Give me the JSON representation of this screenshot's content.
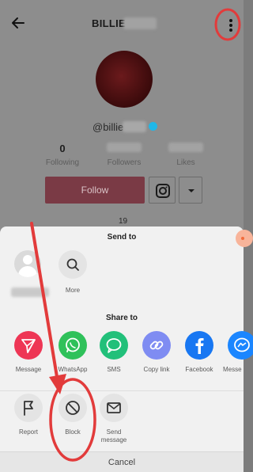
{
  "profile": {
    "username": "BILLIE",
    "handle": "@billie",
    "stats": [
      {
        "value": "0",
        "label": "Following"
      },
      {
        "value": "",
        "label": "Followers"
      },
      {
        "value": "",
        "label": "Likes"
      }
    ],
    "follow_label": "Follow",
    "video_count": "19"
  },
  "sheet": {
    "send_to_title": "Send to",
    "more_label": "More",
    "share_to_title": "Share to",
    "share_targets": [
      {
        "label": "Message",
        "icon": "send-icon",
        "color": "#ee3655"
      },
      {
        "label": "WhatsApp",
        "icon": "whatsapp-icon",
        "color": "#2fc15a"
      },
      {
        "label": "SMS",
        "icon": "sms-icon",
        "color": "#22c07a"
      },
      {
        "label": "Copy link",
        "icon": "link-icon",
        "color": "#7f8cf2"
      },
      {
        "label": "Facebook",
        "icon": "facebook-icon",
        "color": "#1877f2"
      },
      {
        "label": "Messe",
        "icon": "messenger-icon",
        "color": "#1b86ff"
      }
    ],
    "actions": [
      {
        "label": "Report",
        "icon": "flag-icon"
      },
      {
        "label": "Block",
        "icon": "block-icon"
      },
      {
        "label": "Send message",
        "icon": "envelope-icon"
      }
    ],
    "cancel_label": "Cancel"
  },
  "colors": {
    "annotation_red": "#e23b3b",
    "follow_button": "#7a3a45"
  }
}
